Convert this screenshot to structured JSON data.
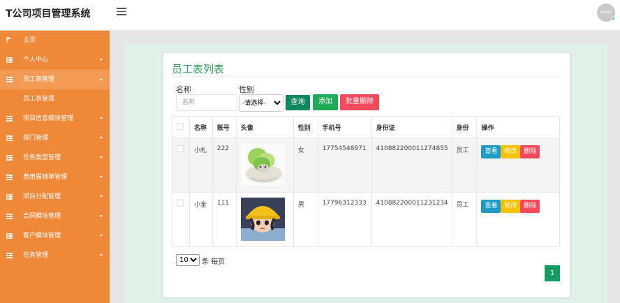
{
  "header": {
    "app_title": "T公司项目管理系统",
    "avatar_text": "80x80"
  },
  "sidebar": {
    "items": [
      {
        "label": "主页",
        "icon": "flag-icon"
      },
      {
        "label": "个人中心",
        "icon": "grid-icon"
      },
      {
        "label": "员工表管理",
        "icon": "grid-icon"
      },
      {
        "label": "员工表管理",
        "icon": ""
      },
      {
        "label": "项目信息模块管理",
        "icon": "grid-icon"
      },
      {
        "label": "部门管理",
        "icon": "grid-icon"
      },
      {
        "label": "任务类型管理",
        "icon": "grid-icon"
      },
      {
        "label": "费用报销单管理",
        "icon": "grid-icon"
      },
      {
        "label": "项目分配管理",
        "icon": "grid-icon"
      },
      {
        "label": "合同模块管理",
        "icon": "grid-icon"
      },
      {
        "label": "客户模块管理",
        "icon": "grid-icon"
      },
      {
        "label": "任务管理",
        "icon": "grid-icon"
      }
    ]
  },
  "main": {
    "title": "员工表列表",
    "search": {
      "name_label": "名称",
      "name_placeholder": "名称",
      "sex_label": "性别",
      "sex_selected": "-请选择-",
      "search_button": "查询",
      "add_button": "添加",
      "batch_delete_button": "批量删除"
    },
    "table": {
      "headers": [
        "名称",
        "账号",
        "头像",
        "性别",
        "手机号",
        "身份证",
        "身份",
        "操作"
      ],
      "rows": [
        {
          "name": "小札",
          "account": "222",
          "sex": "女",
          "phone": "17754548971",
          "id_card": "410882200011274855",
          "role": "员工"
        },
        {
          "name": "小金",
          "account": "111",
          "sex": "男",
          "phone": "17796312333",
          "id_card": "410882200011231234",
          "role": "员工"
        }
      ],
      "actions": {
        "view": "查看",
        "edit": "修改",
        "delete": "删除"
      }
    },
    "pagination": {
      "page_size": "10",
      "per_page_label": "条 每页",
      "current_page": "1"
    }
  }
}
